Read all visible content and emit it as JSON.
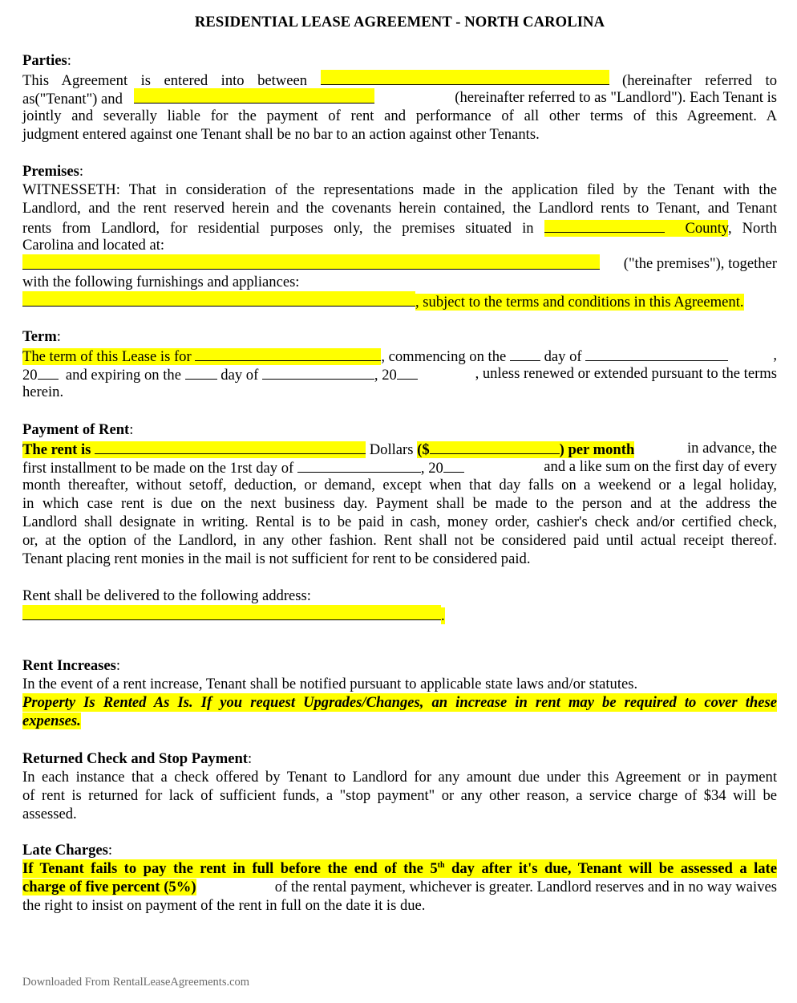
{
  "document": {
    "title": "RESIDENTIAL LEASE AGREEMENT - NORTH CAROLINA",
    "footer": "Downloaded From RentalLeaseAgreements.com",
    "highlight_color": "#ffff00"
  },
  "parties": {
    "heading": "Parties",
    "colon": ":",
    "l1_a": "This Agreement is entered into between",
    "tenant_field": "",
    "l1_b": "(hereinafter referred to",
    "l2_a": "as(\"Tenant\") and",
    "landlord_field": "",
    "l2_b": "(hereinafter referred to as \"Landlord\"). Each Tenant is",
    "l3": "jointly and severally liable for the payment of rent and performance of all other terms of this Agreement. A",
    "l4": "judgment entered against one Tenant shall be no bar to an action against other Tenants."
  },
  "premises": {
    "heading": "Premises",
    "colon": ":",
    "l1": "WITNESSETH: That in consideration of the representations made in the application filed by the Tenant with the",
    "l2": "Landlord, and the rent reserved herein and the covenants herein contained, the Landlord rents to Tenant, and Tenant",
    "l3_a": "rents from Landlord, for residential purposes only, the premises situated in",
    "county_field": "",
    "county_label": "County",
    "l3_b": ", North",
    "l4": "Carolina and located at:",
    "address_field": "",
    "l5_b": "(\"the premises\"), together",
    "l6": "with the following furnishings and appliances:",
    "furnishings_field": "",
    "l7_b": ", subject to the terms and conditions in this Agreement."
  },
  "term": {
    "heading": "Term",
    "colon": ":",
    "l1_hl": "The term of this Lease is for",
    "term_field": "",
    "l1_b": ", commencing on the",
    "l1_c": "day of",
    "l1_d": ",",
    "l2_a": "20",
    "l2_b": "and expiring on the",
    "l2_c": "day of",
    "l2_d": ", 20",
    "l2_e": ", unless renewed or extended pursuant to the terms",
    "l3": "herein."
  },
  "payment": {
    "heading": "Payment of Rent",
    "colon": ":",
    "l1_a": "The rent is",
    "rent_words_field": "",
    "l1_b": "Dollars",
    "l1_c": "($",
    "rent_amount_field": "",
    "l1_d": ") per month",
    "l1_e": "in advance, the",
    "l2_a": "first installment to be made on the 1rst day of",
    "l2_b": ", 20",
    "l2_c": "and a like sum on the first day of every",
    "l3": "month thereafter, without setoff, deduction, or demand, except when that day falls on a weekend or a legal holiday,",
    "l4": "in which case rent is due on the next business day. Payment shall be made to the person and at the address the",
    "l5": "Landlord shall designate in writing. Rental is to be paid in cash, money order, cashier's check and/or certified check,",
    "l6": "or, at the option of the Landlord, in any other fashion. Rent shall not be considered paid until actual receipt thereof.",
    "l7": "Tenant placing rent monies in the mail is not sufficient for rent to be considered paid.",
    "delivery_label": "Rent shall be delivered to the following address:",
    "delivery_field": "",
    "delivery_end": "."
  },
  "rent_increases": {
    "heading": "Rent Increases",
    "colon": ":",
    "l1": "In the event of a rent increase, Tenant shall be notified pursuant to applicable state laws and/or statutes.",
    "l2": "Property Is Rented As Is. If you request Upgrades/Changes, an increase in rent may be required to cover these",
    "l3": "expenses."
  },
  "returned_check": {
    "heading": "Returned Check and Stop Payment",
    "colon": ":",
    "l1": "In each instance that a check offered by Tenant to Landlord for any amount due under this Agreement or in payment",
    "l2": "of rent is returned for lack of sufficient funds, a \"stop payment\" or any other reason, a service charge of $34 will be",
    "l3": "assessed."
  },
  "late_charges": {
    "heading": "Late Charges",
    "colon": ":",
    "l1_a": "If Tenant fails to pay the rent in full before the end of the 5",
    "l1_sup": "th",
    "l1_b": " day after it's due, Tenant will be assessed a late",
    "l2_hl": "charge of five percent (5%)",
    "l2_b": " of the rental payment, whichever is greater. Landlord reserves and in no way waives",
    "l3": "the right to insist on payment of the rent in full on the date it is due."
  }
}
